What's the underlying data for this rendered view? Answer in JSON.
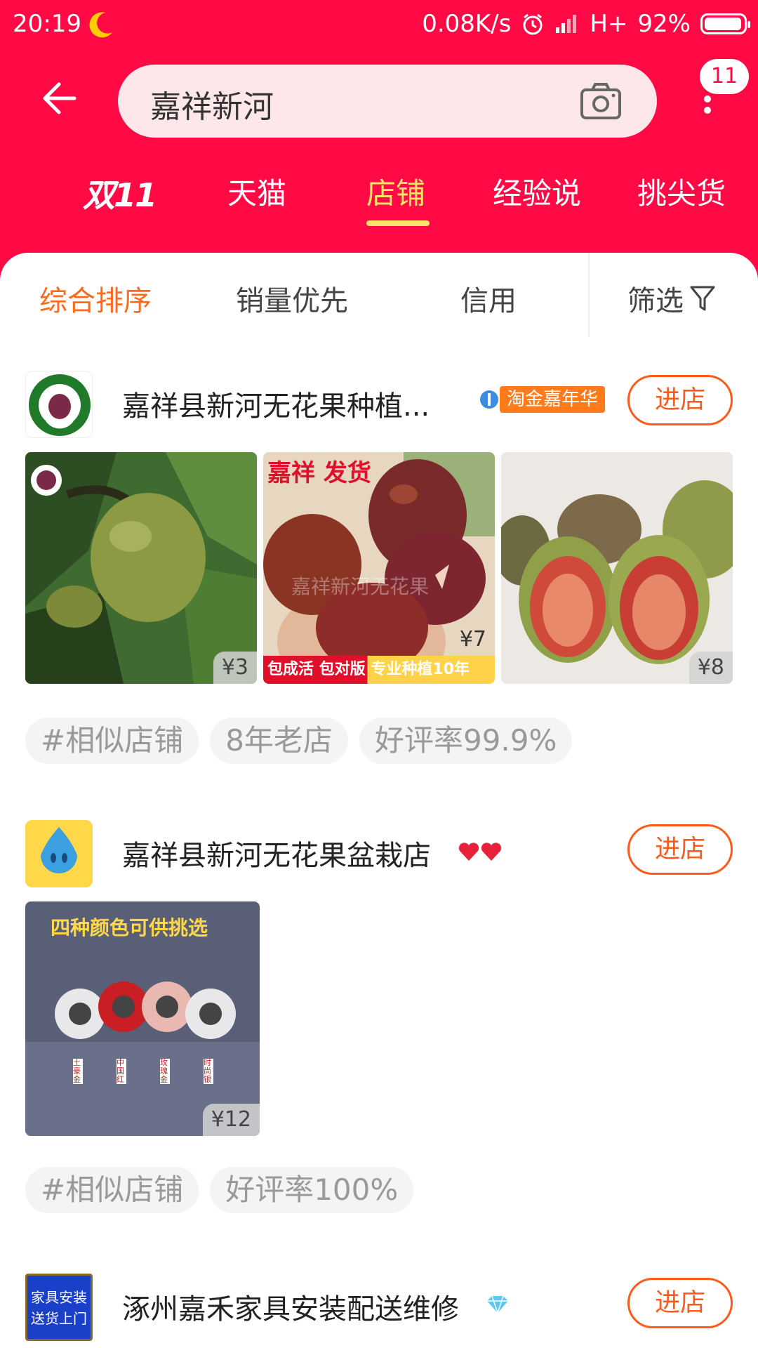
{
  "status_bar": {
    "time": "20:19",
    "network": "0.08K/s",
    "signal": "H+",
    "battery": "92%",
    "battery_level": 0.92
  },
  "search": {
    "query": "嘉祥新河"
  },
  "header": {
    "message_badge": "11"
  },
  "tabs": [
    {
      "label": "双11"
    },
    {
      "label": "天猫"
    },
    {
      "label": "店铺",
      "active": true
    },
    {
      "label": "经验说"
    },
    {
      "label": "挑尖货"
    }
  ],
  "sort": {
    "items": [
      "综合排序",
      "销量优先",
      "信用"
    ],
    "filter_label": "筛选"
  },
  "colors": {
    "brand": "#ff0a45",
    "accent": "#ff6a1a",
    "tab_active": "#ffe36b"
  },
  "shops": [
    {
      "name": "嘉祥县新河无花果种植...",
      "enter_label": "进店",
      "badge": "淘金嘉年华",
      "products": [
        {
          "price": "¥3"
        },
        {
          "price": "¥7",
          "banner_top": "嘉祥 发货",
          "banner_bottom": "包成活 包对版 专业种植10年",
          "watermark": "嘉祥新河无花果"
        },
        {
          "price": "¥8"
        }
      ],
      "tags": [
        "#相似店铺",
        "8年老店",
        "好评率99.9%"
      ]
    },
    {
      "name": "嘉祥县新河无花果盆栽店",
      "enter_label": "进店",
      "products": [
        {
          "price": "¥12",
          "banner_top": "四种颜色可供挑选",
          "labels": [
            "土豪金",
            "中国红",
            "玫瑰金",
            "时尚银"
          ]
        }
      ],
      "tags": [
        "#相似店铺",
        "好评率100%"
      ]
    },
    {
      "name": "涿州嘉禾家具安装配送维修",
      "enter_label": "进店",
      "logo_text": [
        "家具安装",
        "送货上门"
      ]
    }
  ]
}
